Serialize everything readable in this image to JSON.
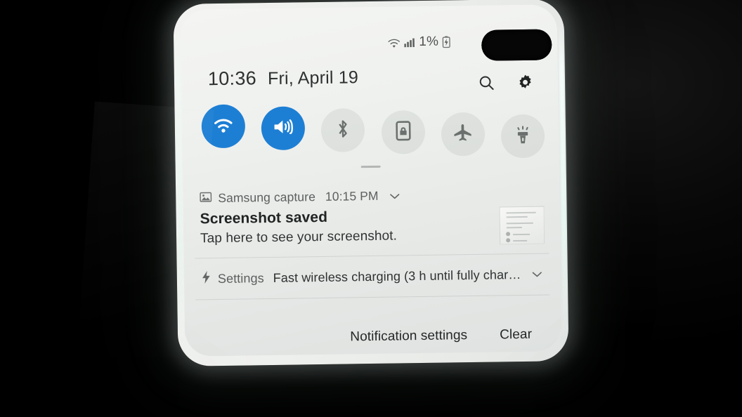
{
  "device": {
    "camera_cutout": "dual-camera-pill"
  },
  "status_bar": {
    "wifi_icon": "wifi-icon",
    "signal_icon": "cellular-signal-icon",
    "battery_percent": "1%",
    "battery_icon": "battery-charging-icon"
  },
  "header": {
    "time": "10:36",
    "date": "Fri, April 19",
    "search_icon": "search-icon",
    "settings_icon": "gear-icon"
  },
  "quick_settings": {
    "toggles": [
      {
        "name": "wifi",
        "label": "Wi-Fi",
        "icon": "wifi-icon",
        "state": "on"
      },
      {
        "name": "sound",
        "label": "Sound",
        "icon": "volume-icon",
        "state": "on"
      },
      {
        "name": "bluetooth",
        "label": "Bluetooth",
        "icon": "bluetooth-icon",
        "state": "off"
      },
      {
        "name": "auto-rotate",
        "label": "Auto rotate",
        "icon": "screen-lock-icon",
        "state": "off"
      },
      {
        "name": "airplane",
        "label": "Airplane mode",
        "icon": "airplane-icon",
        "state": "off"
      },
      {
        "name": "flashlight",
        "label": "Flashlight",
        "icon": "flashlight-icon",
        "state": "off"
      }
    ],
    "drag_handle": "shade-drag-handle"
  },
  "notifications": [
    {
      "app": "Samsung capture",
      "app_icon": "image-icon",
      "time": "10:15 PM",
      "title": "Screenshot saved",
      "body": "Tap here to see your screenshot.",
      "expand_icon": "chevron-down-icon",
      "thumbnail": "screenshot-thumbnail"
    },
    {
      "app": "Settings",
      "app_icon": "lightning-bolt-icon",
      "summary": "Fast wireless charging (3 h until fully char…",
      "expand_icon": "chevron-down-icon"
    }
  ],
  "footer": {
    "notification_settings": "Notification settings",
    "clear": "Clear"
  },
  "colors": {
    "accent_blue": "#1d7fd4",
    "panel_bg": "#eef0ee",
    "text_primary": "#202423",
    "text_secondary": "#5b5f5d",
    "toggle_off_bg": "rgba(120,128,124,0.13)"
  }
}
